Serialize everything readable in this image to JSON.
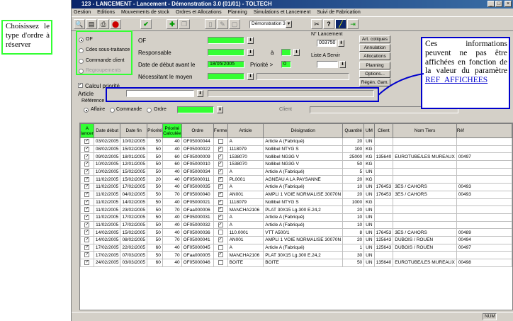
{
  "window": {
    "title": "123 - LANCEMENT - Lancement - Démonstration 3.0 (01/01) - TOLTECH",
    "min": "_",
    "max": "□",
    "close": "×"
  },
  "menu": [
    "Gestion",
    "Editions",
    "Mouvements de stock",
    "Ordres et Allocations",
    "Planning",
    "Simulations et Lancement",
    "Suivi de Fabrication"
  ],
  "toolbar": {
    "company_select": "Démonstration 3"
  },
  "type_options": [
    "OF",
    "Cdes sous-traitance",
    "Commande client",
    "Regroupements"
  ],
  "filters": {
    "of_label": "OF",
    "responsable_label": "Responsable",
    "a_label": "à",
    "date_label": "Date de début avant le",
    "date_value": "18/05/2005",
    "priorite_label": "Priorité >",
    "priorite_value": "0",
    "moyen_label": "Nécessitant le moyen",
    "lancement_label": "N° Lancement",
    "lancement_value": "003750",
    "liste_label": "Liste A Servir",
    "calcul_label": "Calcul priorité",
    "article_label": "Article",
    "reference_label": "Référence",
    "ref_options": [
      "Affaire",
      "Commande",
      "Ordre"
    ],
    "client_label": "Client"
  },
  "side_buttons": [
    "Art. cotiques",
    "Annulation",
    "Allocations",
    "Planning",
    "Options...",
    "Régén. Gam."
  ],
  "callouts": {
    "left": "Choisissez le type d'ordre à réserver",
    "right": "Ces informations peuvent ne pas être affichées en fonction de la valeur du paramètre",
    "right_link": "REF_AFFICHEES"
  },
  "grid": {
    "headers": [
      "A lancer",
      "Date début",
      "Date fin",
      "Priorité",
      "Priorité Calculée",
      "Ordre",
      "Ferme",
      "Article",
      "Désignation",
      "Quantité",
      "UM",
      "Client",
      "Nom Tiers",
      "Réf"
    ],
    "rows": [
      [
        "03/02/2005",
        "10/02/2005",
        "50",
        "40",
        "OF05000044",
        "",
        "A",
        "Article A (Fabriqué)",
        "20",
        "UN",
        "",
        ""
      ],
      [
        "08/02/2005",
        "15/02/2005",
        "50",
        "40",
        "OF05000022",
        "✓",
        "1118079",
        "Nollibel NTYG S",
        "100",
        "KG",
        "",
        ""
      ],
      [
        "09/02/2005",
        "18/01/2005",
        "50",
        "60",
        "OF05000009",
        "✓",
        "1538070",
        "Nollibel NG3G V",
        "25000",
        "KG",
        "135640",
        "EUROTUBE/LES MUREAUX"
      ],
      [
        "10/02/2005",
        "12/01/2005",
        "50",
        "60",
        "OF05000010",
        "✓",
        "1538070",
        "Nollibel NG3G V",
        "50",
        "KG",
        "",
        ""
      ],
      [
        "10/02/2005",
        "15/02/2005",
        "50",
        "40",
        "OF05000034",
        "✓",
        "A",
        "Article A (Fabriqué)",
        "5",
        "UN",
        "",
        ""
      ],
      [
        "11/02/2005",
        "15/02/2005",
        "20",
        "40",
        "OF05000011",
        "✓",
        "PL0001",
        "AGNEAU A LA PAYSANNE",
        "20",
        "KG",
        "",
        ""
      ],
      [
        "11/02/2005",
        "17/02/2005",
        "50",
        "40",
        "OF05000035",
        "✓",
        "A",
        "Article A (Fabriqué)",
        "10",
        "UN",
        "176453",
        "3ES / CAHORS"
      ],
      [
        "11/02/2005",
        "04/02/2005",
        "50",
        "70",
        "OF05000040",
        "✓",
        "AN001",
        "AMPLI 1 VOIE NORMALISE 30070N",
        "20",
        "UN",
        "176453",
        "3ES / CAHORS"
      ],
      [
        "11/02/2005",
        "14/02/2005",
        "50",
        "40",
        "OF05000021",
        "✓",
        "1118079",
        "Nollibel NTYG S",
        "1000",
        "KG",
        "",
        ""
      ],
      [
        "11/02/2005",
        "23/02/2005",
        "50",
        "70",
        "OFaa000006",
        "✓",
        "MANCHA2106",
        "PLAT 30X15 Lg.300 E.24,2",
        "20",
        "UN",
        "",
        ""
      ],
      [
        "11/02/2005",
        "17/02/2005",
        "50",
        "40",
        "OF05000031",
        "✓",
        "A",
        "Article A (Fabriqué)",
        "10",
        "UN",
        "",
        ""
      ],
      [
        "11/02/2005",
        "17/02/2005",
        "50",
        "40",
        "OF05000032",
        "✓",
        "A",
        "Article A (Fabriqué)",
        "10",
        "UN",
        "",
        ""
      ],
      [
        "14/02/2005",
        "15/02/2005",
        "50",
        "40",
        "OF05000036",
        "",
        "110.0001",
        "VTT A500/1",
        "8",
        "UN",
        "176453",
        "3ES / CAHORS"
      ],
      [
        "14/02/2005",
        "08/02/2005",
        "50",
        "70",
        "OF05000041",
        "✓",
        "AN001",
        "AMPLI 1 VOIE NORMALISE 30070N",
        "20",
        "UN",
        "125643",
        "DUBOIS / ROUEN"
      ],
      [
        "17/02/2005",
        "22/02/2005",
        "60",
        "40",
        "OF05000045",
        "",
        "A",
        "Article A (Fabriqué)",
        "1",
        "UN",
        "125643",
        "DUBOIS / ROUEN"
      ],
      [
        "17/02/2005",
        "07/03/2005",
        "50",
        "70",
        "OFaa000005",
        "✓",
        "MANCHA2106",
        "PLAT 30X15 Lg.300 E.24,2",
        "30",
        "UN",
        "",
        ""
      ],
      [
        "24/02/2005",
        "03/03/2005",
        "60",
        "40",
        "OF05000046",
        "",
        "BOITE",
        "BOITE",
        "50",
        "UN",
        "135640",
        "EUROTUBE/LES MUREAUX"
      ]
    ],
    "ref_col": [
      "",
      "",
      "00497",
      "",
      "",
      "",
      "00493",
      "00493",
      "",
      "",
      "",
      "",
      "00489",
      "00494",
      "00497",
      "",
      "00498"
    ]
  },
  "status": {
    "num": "NUM"
  },
  "colors": {
    "highlight_green": "#33ff33",
    "frame_blue": "#0000cc",
    "title_blue": "#0a246a"
  }
}
